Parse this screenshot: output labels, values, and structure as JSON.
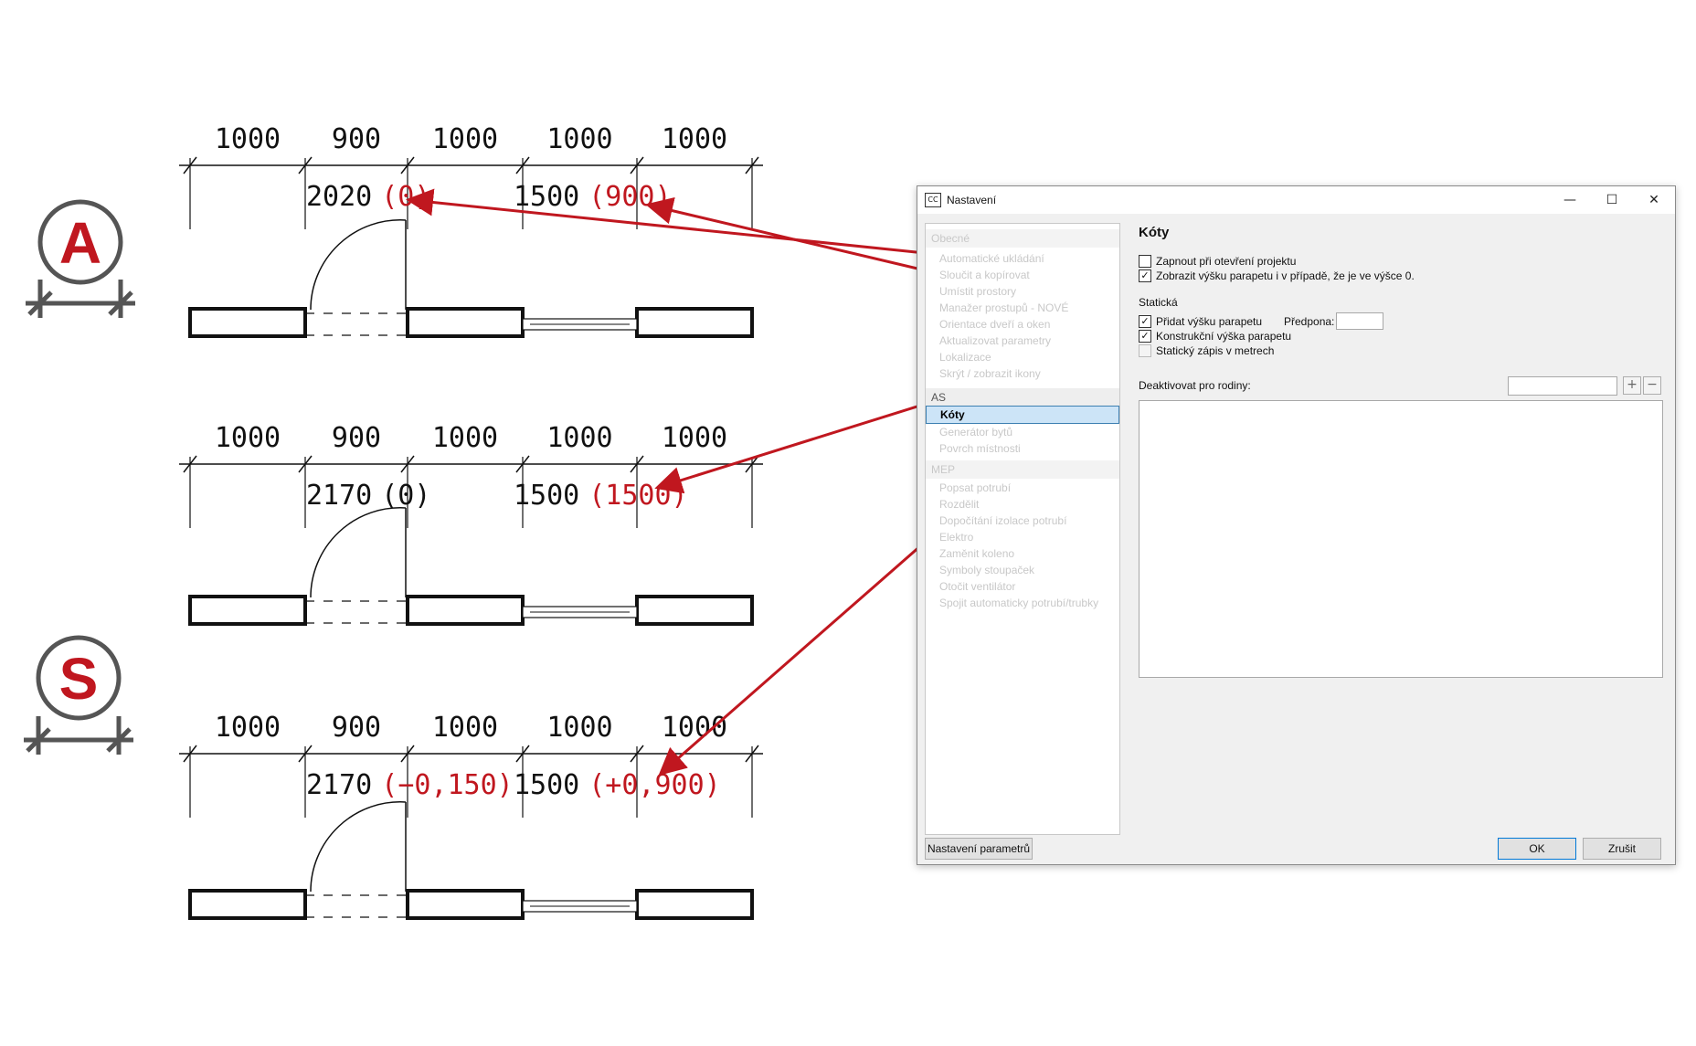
{
  "drawing": {
    "badges": [
      {
        "letter": "A",
        "color": "#c0171f"
      },
      {
        "letter": "S",
        "color": "#c0171f"
      }
    ],
    "rows": [
      {
        "top_dims": [
          "1000",
          "900",
          "1000",
          "1000",
          "1000"
        ],
        "door_main": "2020",
        "door_extra": "(0)",
        "door_extra_red": true,
        "win_main": "1500",
        "win_extra": "(900)",
        "win_extra_red": true
      },
      {
        "top_dims": [
          "1000",
          "900",
          "1000",
          "1000",
          "1000"
        ],
        "door_main": "2170",
        "door_extra": "(0)",
        "door_extra_red": false,
        "win_main": "1500",
        "win_extra": "(1500)",
        "win_extra_red": true
      },
      {
        "top_dims": [
          "1000",
          "900",
          "1000",
          "1000",
          "1000"
        ],
        "door_main": "2170",
        "door_extra": "(−0,150)",
        "door_extra_red": true,
        "win_main": "1500",
        "win_extra": "(+0,900)",
        "win_extra_red": true
      }
    ],
    "arrow_color": "#c0171f"
  },
  "dialog": {
    "title": "Nastavení",
    "app_icon": "CC",
    "window_buttons": {
      "minimize": "—",
      "maximize": "☐",
      "close": "✕"
    },
    "nav": [
      {
        "type": "group",
        "label": "Obecné",
        "active": false
      },
      {
        "type": "item",
        "label": "Automatické ukládání"
      },
      {
        "type": "item",
        "label": "Sloučit a kopírovat"
      },
      {
        "type": "item",
        "label": "Umístit prostory"
      },
      {
        "type": "item",
        "label": "Manažer prostupů - NOVÉ"
      },
      {
        "type": "item",
        "label": "Orientace dveří a oken"
      },
      {
        "type": "item",
        "label": "Aktualizovat parametry"
      },
      {
        "type": "item",
        "label": "Lokalizace"
      },
      {
        "type": "item",
        "label": "Skrýt / zobrazit ikony"
      },
      {
        "type": "group",
        "label": "AS",
        "active": true
      },
      {
        "type": "item",
        "label": "Kóty",
        "selected": true
      },
      {
        "type": "item",
        "label": "Generátor bytů"
      },
      {
        "type": "item",
        "label": "Povrch místnosti"
      },
      {
        "type": "group",
        "label": "MEP",
        "active": false
      },
      {
        "type": "item",
        "label": "Popsat potrubí"
      },
      {
        "type": "item",
        "label": "Rozdělit"
      },
      {
        "type": "item",
        "label": "Dopočítání izolace potrubí"
      },
      {
        "type": "item",
        "label": "Elektro"
      },
      {
        "type": "item",
        "label": "Zaměnit koleno"
      },
      {
        "type": "item",
        "label": "Symboly stoupaček"
      },
      {
        "type": "item",
        "label": "Otočit ventilátor"
      },
      {
        "type": "item",
        "label": "Spojit automaticky potrubí/trubky"
      }
    ],
    "section_title": "Kóty",
    "options": [
      {
        "label": "Zapnout při otevření projektu",
        "checked": false
      },
      {
        "label": "Zobrazit výšku parapetu i v případě, že je ve výšce 0.",
        "checked": true
      }
    ],
    "static_heading": "Statická",
    "static_options": [
      {
        "label": "Přidat výšku parapetu",
        "checked": true
      },
      {
        "label": "Konstrukční výška parapetu",
        "checked": true
      },
      {
        "label": "Statický zápis v metrech",
        "checked": false,
        "disabled": true
      }
    ],
    "prefix_label": "Předpona:",
    "prefix_value": "",
    "deactivate_label": "Deaktivovat pro rodiny:",
    "deactivate_value": "",
    "add_symbol": "+",
    "remove_symbol": "−",
    "param_button": "Nastavení parametrů",
    "ok_button": "OK",
    "cancel_button": "Zrušit"
  }
}
